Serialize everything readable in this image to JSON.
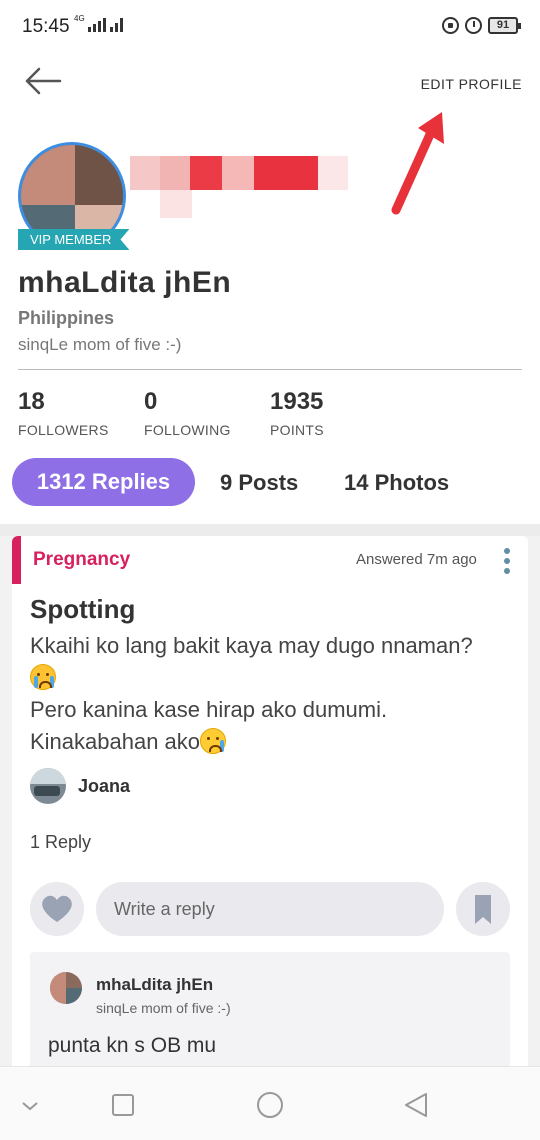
{
  "status_bar": {
    "time": "15:45",
    "network": "4G",
    "battery": "91"
  },
  "header": {
    "edit_profile_label": "EDIT PROFILE"
  },
  "profile": {
    "badge": "VIP MEMBER",
    "name": "mhaLdita  jhEn",
    "country": "Philippines",
    "bio": "sinqLe mom of five :-)"
  },
  "stats": [
    {
      "value": "18",
      "label": "FOLLOWERS"
    },
    {
      "value": "0",
      "label": "FOLLOWING"
    },
    {
      "value": "1935",
      "label": "POINTS"
    }
  ],
  "tabs": {
    "replies": "1312 Replies",
    "posts": "9 Posts",
    "photos": "14 Photos"
  },
  "card": {
    "category": "Pregnancy",
    "answered": "Answered 7m ago",
    "title": "Spotting",
    "body_line1": "Kkaihi ko lang bakit kaya may dugo nnaman?",
    "body_line2": "Pero kanina kase hirap ako dumumi.",
    "body_line3": "Kinakabahan ako",
    "asker": "Joana",
    "reply_count": "1 Reply",
    "reply_placeholder": "Write a reply",
    "reply": {
      "name": "mhaLdita  jhEn",
      "bio": "sinqLe mom of five :-)",
      "text": "punta kn s OB mu"
    }
  },
  "colors": {
    "accent_purple": "#8e6fe6",
    "category_pink": "#d6215e",
    "vip_teal": "#26a6b2",
    "avatar_ring": "#3d8ee0"
  }
}
